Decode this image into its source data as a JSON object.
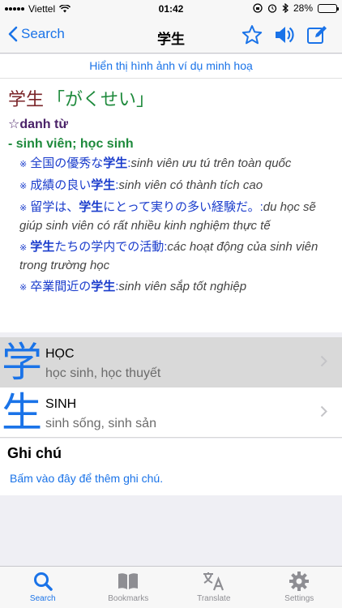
{
  "status": {
    "carrier": "Viettel",
    "time": "01:42",
    "battery_text": "28%",
    "battery_level": 0.28
  },
  "nav": {
    "back_label": "Search",
    "title": "学生"
  },
  "show_images_link": "Hiển thị hình ảnh ví dụ minh hoạ",
  "entry": {
    "word": "学生",
    "reading": "「がくせい」",
    "star": "☆",
    "pos": "danh từ",
    "meaning": "- sinh viên; học sinh",
    "examples": [
      {
        "mark": "※",
        "jp_before": "全国の優秀な",
        "kw": "学生",
        "jp_after": ":",
        "vi": "sinh viên ưu tú trên toàn quốc"
      },
      {
        "mark": "※",
        "jp_before": "成績の良い",
        "kw": "学生",
        "jp_after": ":",
        "vi": "sinh viên có thành tích cao"
      },
      {
        "mark": "※",
        "jp_before": "留学は、",
        "kw": "学生",
        "jp_after": "にとって実りの多い経験だ。:",
        "vi": "du học sẽ giúp sinh viên có rất nhiều kinh nghiệm thực tế"
      },
      {
        "mark": "※",
        "jp_before": "",
        "kw": "学生",
        "jp_after": "たちの学内での活動:",
        "vi": "các hoạt động của sinh viên trong trường học"
      },
      {
        "mark": "※",
        "jp_before": "卒業間近の",
        "kw": "学生",
        "jp_after": ":",
        "vi": "sinh viên sắp tốt nghiệp"
      }
    ]
  },
  "kanji": [
    {
      "char": "学",
      "name": "HỌC",
      "meaning": "học sinh, học thuyết",
      "selected": true
    },
    {
      "char": "生",
      "name": "SINH",
      "meaning": "sinh sống, sinh sản",
      "selected": false
    }
  ],
  "notes": {
    "title": "Ghi chú",
    "add_label": "Bấm vào đây để thêm ghi chú."
  },
  "tabs": [
    {
      "label": "Search",
      "icon": "search-icon",
      "active": true
    },
    {
      "label": "Bookmarks",
      "icon": "book-icon",
      "active": false
    },
    {
      "label": "Translate",
      "icon": "translate-icon",
      "active": false
    },
    {
      "label": "Settings",
      "icon": "gear-icon",
      "active": false
    }
  ],
  "colors": {
    "accent": "#1a73e8",
    "headword": "#7a2428",
    "reading": "#1e8a3c",
    "pos": "#4a2268",
    "example_jp": "#1a3ccc"
  }
}
